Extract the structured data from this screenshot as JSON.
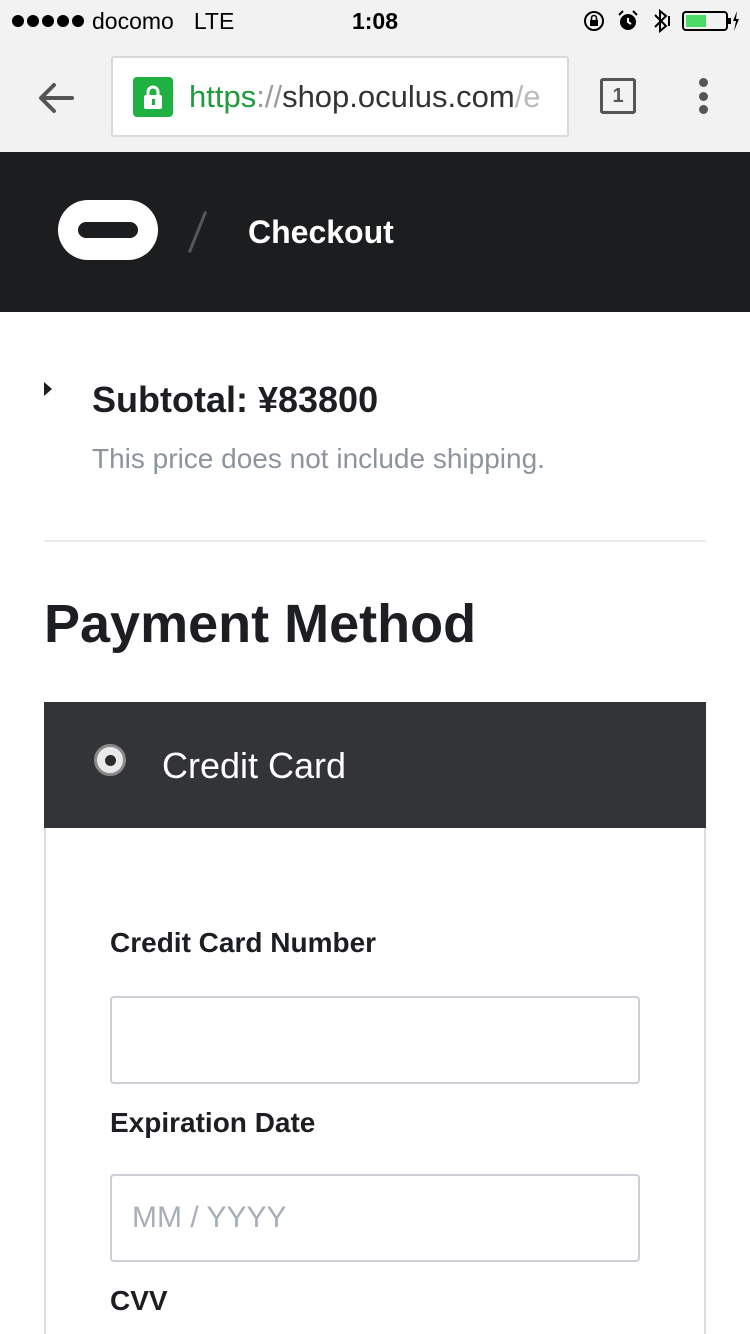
{
  "status_bar": {
    "carrier": "docomo",
    "network": "LTE",
    "time": "1:08",
    "signal_icon": "signal-dots-icon",
    "battery_icon": "battery-charging-icon"
  },
  "browser": {
    "url_scheme": "https",
    "url_separator": "://",
    "url_host": "shop.oculus.com",
    "url_rest": "/e",
    "tab_count": "1",
    "back_icon": "back-arrow-icon",
    "lock_icon": "lock-icon",
    "menu_icon": "overflow-menu-icon",
    "colors": {
      "secure": "#1fb141",
      "scheme_text": "#1f9b3c"
    }
  },
  "header": {
    "logo": "oculus-logo",
    "title": "Checkout",
    "background": "#1c1d1f"
  },
  "summary": {
    "subtotal": "Subtotal: ¥83800",
    "note": "This price does not include shipping."
  },
  "payment": {
    "title": "Payment Method",
    "selected_method": "Credit Card",
    "fields": {
      "card_number_label": "Credit Card Number",
      "card_number_value": "",
      "expiration_label": "Expiration Date",
      "expiration_placeholder": "MM / YYYY",
      "cvv_label": "CVV"
    }
  }
}
